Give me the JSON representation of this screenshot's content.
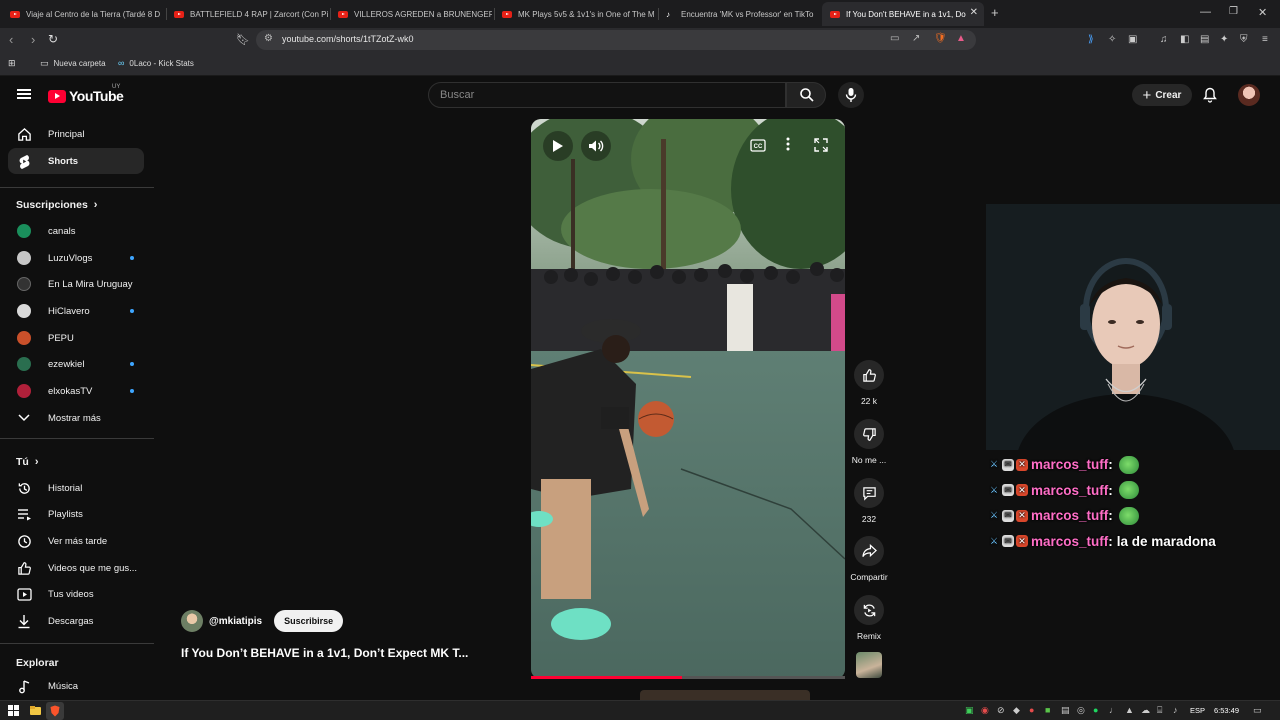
{
  "browser": {
    "tabs": [
      {
        "title": "Viaje al Centro de la Tierra (Tardé 8 D",
        "favicon": "youtube-icon"
      },
      {
        "title": "BATTLEFIELD 4 RAP | Zarcort (Con Pi",
        "favicon": "youtube-icon"
      },
      {
        "title": "VILLEROS AGREDEN a BRUNENGER y",
        "favicon": "youtube-icon"
      },
      {
        "title": "MK Plays 5v5 & 1v1's in One of The M",
        "favicon": "youtube-icon"
      },
      {
        "title": "Encuentra 'MK vs Professor' en TikTo",
        "favicon": "tiktok-icon"
      },
      {
        "title": "If You Don't BEHAVE in a 1v1, Do",
        "favicon": "youtube-icon",
        "active": true
      }
    ],
    "url": "youtube.com/shorts/1tTZotZ-wk0",
    "bookmarks": [
      {
        "label": "Nueva carpeta",
        "icon": "folder-icon"
      },
      {
        "label": "0Laco - Kick Stats",
        "icon": "kick-icon"
      }
    ]
  },
  "header": {
    "logo_text": "YouTube",
    "country_code": "UY",
    "search_placeholder": "Buscar",
    "create_label": "Crear"
  },
  "sidebar": {
    "main": [
      {
        "label": "Principal",
        "icon": "home-icon"
      },
      {
        "label": "Shorts",
        "icon": "shorts-icon",
        "active": true
      }
    ],
    "subscriptions_title": "Suscripciones",
    "subscriptions": [
      {
        "label": "canals",
        "live": false,
        "color": "#1a8f5c"
      },
      {
        "label": "LuzuVlogs",
        "live": true,
        "color": "#c7c7c7"
      },
      {
        "label": "En La Mira Uruguay",
        "live": false,
        "color": "#333333"
      },
      {
        "label": "HiClavero",
        "live": true,
        "color": "#d9d9d9"
      },
      {
        "label": "PEPU",
        "live": false,
        "color": "#c9502a"
      },
      {
        "label": "ezewkiel",
        "live": true,
        "color": "#2a6e4f"
      },
      {
        "label": "elxokasTV",
        "live": true,
        "color": "#b0203a"
      }
    ],
    "show_more": "Mostrar más",
    "you_title": "Tú",
    "you_items": [
      {
        "label": "Historial",
        "icon": "history-icon"
      },
      {
        "label": "Playlists",
        "icon": "playlist-icon"
      },
      {
        "label": "Ver más tarde",
        "icon": "clock-icon"
      },
      {
        "label": "Videos que me gus...",
        "icon": "thumb-up-icon"
      },
      {
        "label": "Tus videos",
        "icon": "video-icon"
      },
      {
        "label": "Descargas",
        "icon": "download-icon"
      }
    ],
    "explore_title": "Explorar",
    "explore_items": [
      {
        "label": "Música",
        "icon": "music-icon"
      }
    ]
  },
  "short": {
    "channel": "@mkiatipis",
    "subscribe_label": "Suscribirse",
    "title": "If You Don’t BEHAVE in a 1v1, Don’t Expect MK T...",
    "progress": 0.48,
    "actions": [
      {
        "label": "22 k",
        "icon": "thumb-up-icon"
      },
      {
        "label": "No me ...",
        "icon": "thumb-down-icon"
      },
      {
        "label": "232",
        "icon": "comment-icon"
      },
      {
        "label": "Compartir",
        "icon": "share-icon"
      },
      {
        "label": "Remix",
        "icon": "remix-icon"
      }
    ]
  },
  "chat": [
    {
      "user": "marcos_tuff",
      "message": "",
      "emote": true
    },
    {
      "user": "marcos_tuff",
      "message": "",
      "emote": true
    },
    {
      "user": "marcos_tuff",
      "message": "",
      "emote": true
    },
    {
      "user": "marcos_tuff",
      "message": "la de maradona",
      "emote": false
    }
  ],
  "taskbar": {
    "language": "ESP",
    "time": "6:53:49"
  },
  "colors": {
    "accent": "#ff0033",
    "background": "#0f0f0f",
    "chat_user": "#ff6ec7",
    "live_dot": "#3ea6ff"
  }
}
